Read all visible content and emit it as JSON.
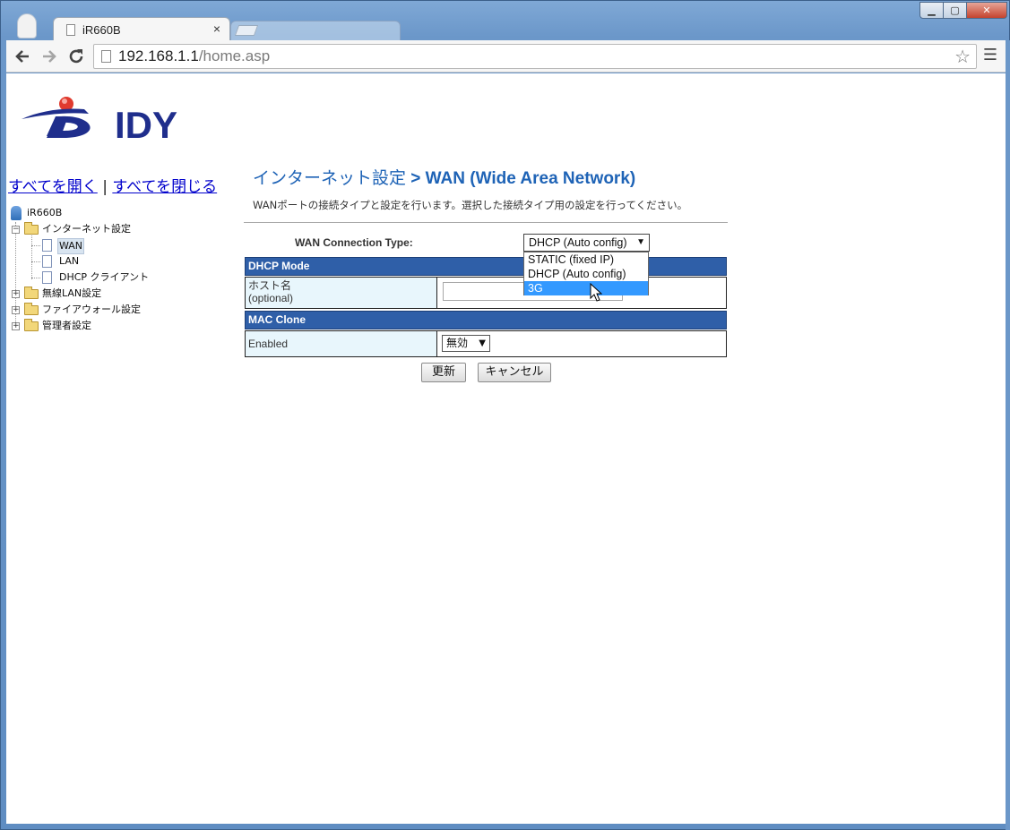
{
  "browser": {
    "active_tab_title": "iR660B",
    "tab_close": "×",
    "url_host": "192.168.1.1",
    "url_path": "/home.asp",
    "window_controls": {
      "minimize": "▁",
      "maximize": "▢",
      "close": "✕"
    },
    "icons": {
      "back": "arrow-left-icon",
      "forward": "arrow-right-icon",
      "reload": "reload-icon",
      "star": "star-icon",
      "menu": "menu-icon"
    }
  },
  "sidebar": {
    "brand": "IDY",
    "expand_all": "すべてを開く",
    "separator": "|",
    "collapse_all": "すべてを閉じる",
    "tree": {
      "root": "iR660B",
      "internet": "インターネット設定",
      "wan": "WAN",
      "lan": "LAN",
      "dhcp_client": "DHCP クライアント",
      "wireless": "無線LAN設定",
      "firewall": "ファイアウォール設定",
      "admin": "管理者設定"
    }
  },
  "main": {
    "title_crumb": "インターネット設定",
    "title_sep": " > ",
    "title_main": "WAN (Wide Area Network)",
    "description": "WANポートの接続タイプと設定を行います。選択した接続タイプ用の設定を行ってください。",
    "connection_type_label": "WAN Connection Type:",
    "connection_type_value": "DHCP (Auto config)",
    "connection_options": [
      "STATIC (fixed IP)",
      "DHCP (Auto config)",
      "3G"
    ],
    "highlighted_option": "3G",
    "dhcp_section": "DHCP Mode",
    "hostname_label": "ホスト名",
    "hostname_optional": "(optional)",
    "hostname_value": "",
    "mac_section": "MAC Clone",
    "enabled_label": "Enabled",
    "enabled_value": "無効",
    "update_button": "更新",
    "cancel_button": "キャンセル"
  },
  "colors": {
    "accent": "#1e63b6",
    "section_bar": "#2f5fa8",
    "label_cell": "#e8f6fc",
    "highlight": "#3399ff"
  }
}
